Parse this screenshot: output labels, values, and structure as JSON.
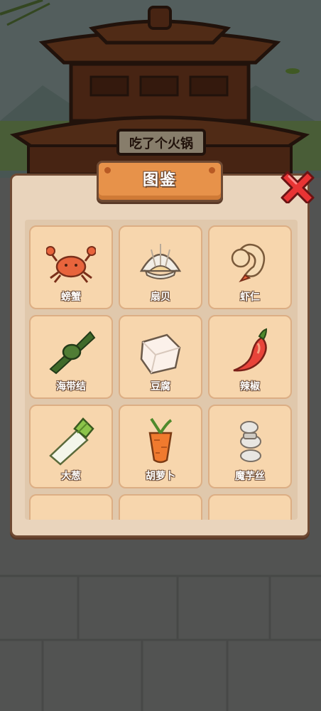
{
  "scene": {
    "sign_text": "吃了个火锅"
  },
  "dialog": {
    "title": "图鉴",
    "close_icon": "close-x-icon"
  },
  "items": [
    {
      "label": "螃蟹",
      "icon": "crab-icon"
    },
    {
      "label": "扇贝",
      "icon": "scallop-icon"
    },
    {
      "label": "虾仁",
      "icon": "shrimp-icon"
    },
    {
      "label": "海带结",
      "icon": "kelp-knot-icon"
    },
    {
      "label": "豆腐",
      "icon": "tofu-icon"
    },
    {
      "label": "辣椒",
      "icon": "chili-pepper-icon"
    },
    {
      "label": "大葱",
      "icon": "scallion-icon"
    },
    {
      "label": "胡萝卜",
      "icon": "carrot-icon"
    },
    {
      "label": "魔芋丝",
      "icon": "konjac-noodle-icon"
    }
  ],
  "colors": {
    "panel": "#e9d4bc",
    "card": "#f7d6ad",
    "title_plate": "#e7924a",
    "close_red": "#e83434",
    "outline": "#6f4a33"
  }
}
